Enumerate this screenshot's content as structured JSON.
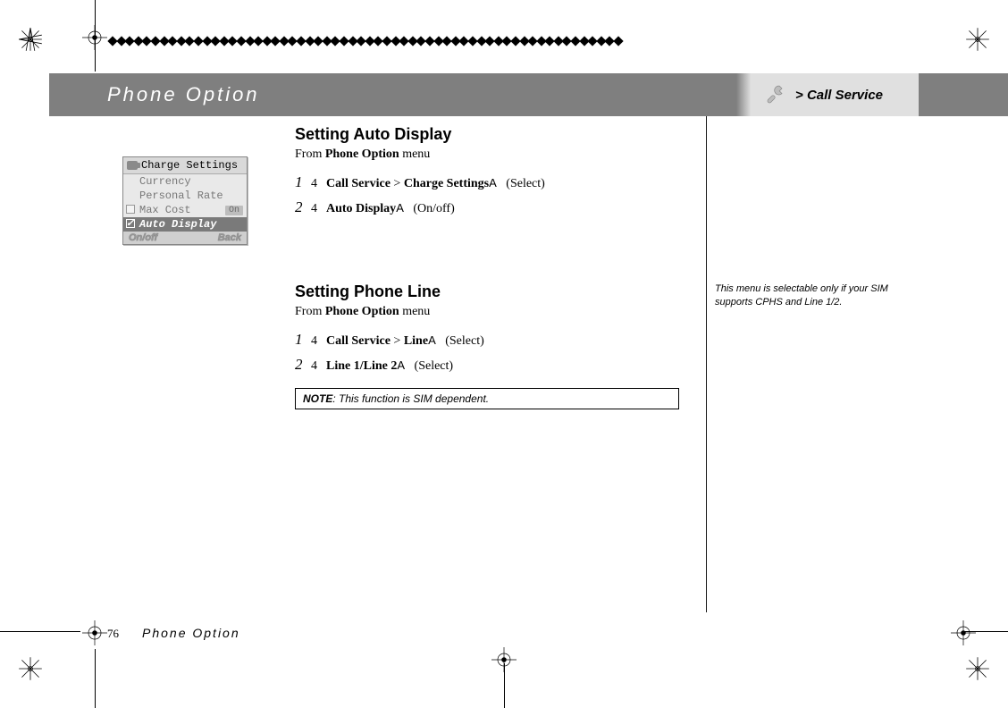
{
  "header": {
    "title": "Phone Option",
    "breadcrumb": "> Call Service"
  },
  "diamond_count": 60,
  "phone_mock": {
    "title": "Charge Settings",
    "rows": [
      "Currency",
      "Personal Rate"
    ],
    "max_label": "Max Cost",
    "max_badge": "On",
    "selected": "Auto Display",
    "foot_left": "On/off",
    "foot_right": "Back"
  },
  "section1": {
    "heading": "Setting Auto Display",
    "from_prefix": "From ",
    "from_bold": "Phone Option",
    "from_suffix": " menu",
    "steps": [
      {
        "n": "1",
        "four": "4",
        "bold1": "Call Service",
        "sep": " > ",
        "bold2": "Charge Settings",
        "arrow": "A",
        "action": "(Select)"
      },
      {
        "n": "2",
        "four": "4",
        "bold1": "Auto Display",
        "sep": "",
        "bold2": "",
        "arrow": "A",
        "action": "(On/off)"
      }
    ]
  },
  "section2": {
    "heading": "Setting Phone Line",
    "from_prefix": "From ",
    "from_bold": "Phone Option",
    "from_suffix": " menu",
    "steps": [
      {
        "n": "1",
        "four": "4",
        "bold1": "Call Service",
        "sep": " > ",
        "bold2": "Line",
        "arrow": "A",
        "action": "(Select)"
      },
      {
        "n": "2",
        "four": "4",
        "bold1": "Line 1/Line 2",
        "sep": "",
        "bold2": "",
        "arrow": "A",
        "action": "(Select)"
      }
    ],
    "note_label": "NOTE",
    "note_text": ": This function is SIM dependent."
  },
  "sidebar_note": "This menu is selectable only if your SIM supports CPHS and Line 1/2.",
  "footer": {
    "page": "76",
    "title": "Phone Option"
  }
}
